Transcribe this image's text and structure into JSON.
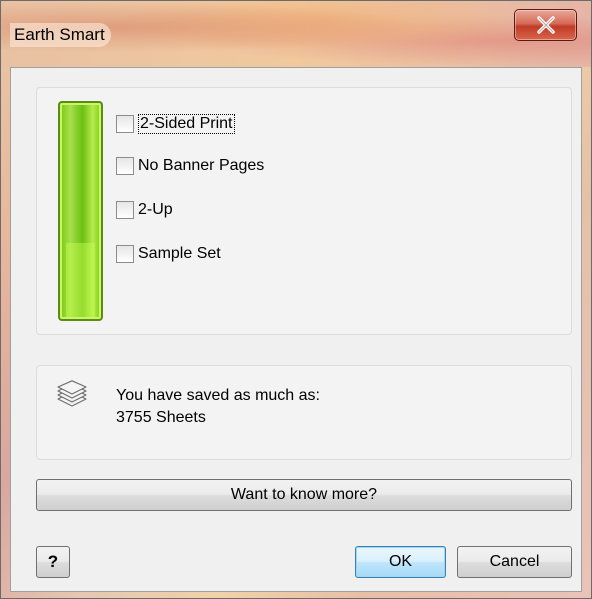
{
  "window": {
    "title": "Earth Smart",
    "close_icon": "close-icon"
  },
  "options": {
    "items": [
      {
        "label": "2-Sided Print",
        "checked": false
      },
      {
        "label": "No Banner Pages",
        "checked": false
      },
      {
        "label": "2-Up",
        "checked": false
      },
      {
        "label": "Sample Set",
        "checked": false
      }
    ],
    "meter_icon": "green-meter"
  },
  "savings": {
    "icon": "paper-stack-icon",
    "line1": "You have saved as much as:",
    "line2": "3755 Sheets"
  },
  "buttons": {
    "more_label": "Want to know more?",
    "help_label": "?",
    "ok_label": "OK",
    "cancel_label": "Cancel"
  },
  "colors": {
    "meter_green": "#79c80e",
    "close_red": "#c13b26"
  }
}
